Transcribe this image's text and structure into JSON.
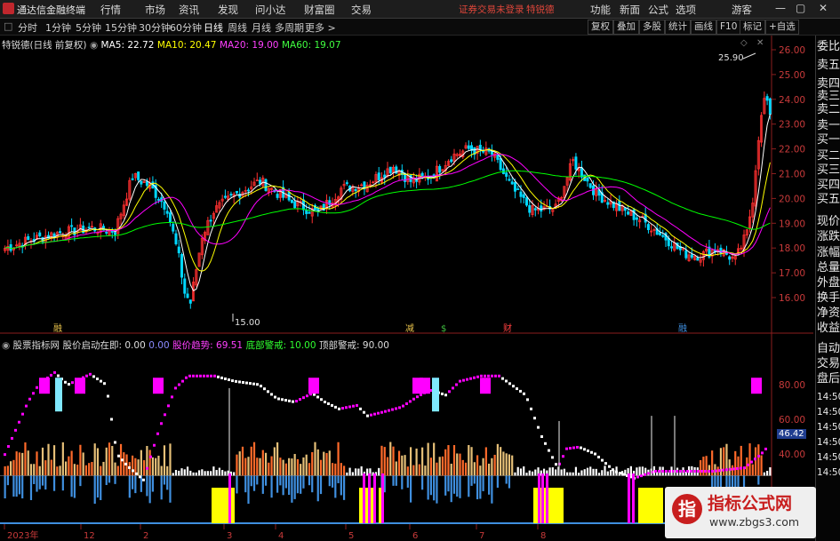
{
  "menubar": {
    "app_name": "通达信金融终端",
    "menus": [
      "行情",
      "市场",
      "资讯",
      "发现",
      "问小达",
      "财富圈",
      "交易"
    ],
    "login_warning": "证券交易未登录",
    "user": "特锐德",
    "right_items": [
      "功能",
      "新面",
      "公式",
      "选项",
      "游客"
    ]
  },
  "toolbar": {
    "periods": [
      "分时",
      "1分钟",
      "5分钟",
      "15分钟",
      "30分钟",
      "60分钟",
      "日线",
      "周线",
      "月线",
      "多周期",
      "更多 >"
    ],
    "active_period": "日线",
    "right_buttons": [
      "复权",
      "叠加",
      "多股",
      "统计",
      "画线",
      "F10",
      "标记",
      "+自选"
    ]
  },
  "price_pane": {
    "title": "特锐德(日线 前复权)",
    "ma": [
      {
        "label": "MA5: 22.72",
        "color": "#ffffff"
      },
      {
        "label": "MA10: 20.47",
        "color": "#ffff00"
      },
      {
        "label": "MA20: 19.00",
        "color": "#ff00ff"
      },
      {
        "label": "MA60: 19.07",
        "color": "#00ff00"
      }
    ],
    "y_ticks": [
      "26.00",
      "25.00",
      "24.00",
      "23.00",
      "22.00",
      "21.00",
      "20.00",
      "19.00",
      "18.00",
      "17.00",
      "16.00"
    ],
    "high_marker": "25.90",
    "low_marker": "15.00",
    "event_marks": [
      "融",
      "减",
      "$",
      "财",
      "融"
    ]
  },
  "indicator_pane": {
    "title": "股票指标网",
    "items": [
      {
        "label": "股价启动在即: 0.00",
        "color": "#dddddd"
      },
      {
        "label": "0.00",
        "color": "#8a8aff"
      },
      {
        "label": "股价趋势: 69.51",
        "color": "#ff40ff"
      },
      {
        "label": "底部警戒: 10.00",
        "color": "#30ff30"
      },
      {
        "label": "顶部警戒: 90.00",
        "color": "#dddddd"
      }
    ],
    "y_ticks": [
      "80.00",
      "60.00",
      "40.00"
    ],
    "current_value": "46.42"
  },
  "x_axis": {
    "labels": [
      "2023年",
      "12",
      "2",
      "3",
      "4",
      "5",
      "6",
      "7",
      "8"
    ]
  },
  "side_panel": {
    "items": [
      "委比",
      "卖五",
      "卖四",
      "卖三",
      "卖二",
      "卖一",
      "买一",
      "买二",
      "买三",
      "买四",
      "买五",
      "现价",
      "涨跌",
      "涨幅",
      "总量",
      "外盘",
      "换手",
      "净资",
      "收益",
      "自动",
      "交易",
      "盘后"
    ],
    "times": [
      "14:50",
      "14:50",
      "14:50",
      "14:50",
      "14:50",
      "14:50"
    ]
  },
  "watermark": {
    "title": "指标公式网",
    "url": "www.zbgs3.com"
  },
  "colors": {
    "up": "#ff3030",
    "down": "#00d8ff",
    "trend": "#ff00ff",
    "volume_down": "#3f8fdf",
    "yellow_block": "#ffff00"
  }
}
